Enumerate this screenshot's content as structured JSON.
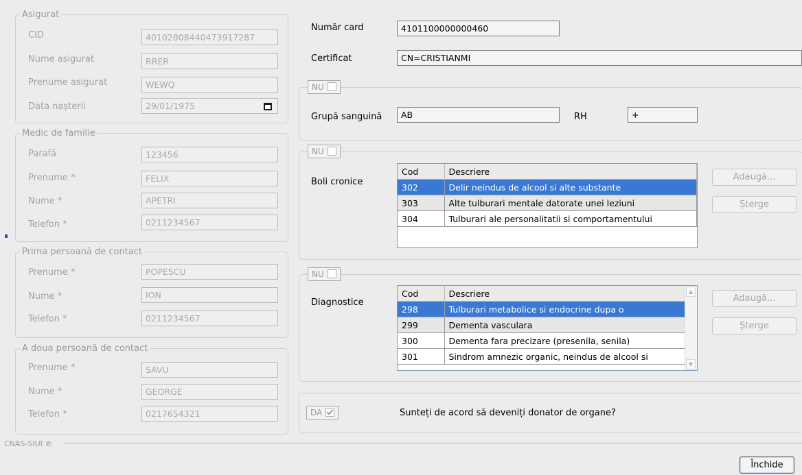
{
  "insured": {
    "title": "Asigurat",
    "cid_label": "CID",
    "cid_value": "40102808440473917287",
    "last_name_label": "Nume asigurat",
    "last_name_value": "RRER",
    "first_name_label": "Prenume asigurat",
    "first_name_value": "WEWQ",
    "birth_label": "Data nașterii",
    "birth_value": "29/01/1975"
  },
  "family_doctor": {
    "title": "Medic de familie",
    "stamp_label": "Parafă",
    "stamp_value": "123456",
    "first_name_label": "Prenume *",
    "first_name_value": "FELIX",
    "last_name_label": "Nume *",
    "last_name_value": "APETRI",
    "phone_label": "Telefon *",
    "phone_value": "0211234567"
  },
  "contact1": {
    "title": "Prima persoană de contact",
    "first_name_label": "Prenume *",
    "first_name_value": "POPESCU",
    "last_name_label": "Nume *",
    "last_name_value": "ION",
    "phone_label": "Telefon *",
    "phone_value": "0211234567"
  },
  "contact2": {
    "title": "A doua persoană de contact",
    "first_name_label": "Prenume *",
    "first_name_value": "SAVU",
    "last_name_label": "Nume *",
    "last_name_value": "GEORGE",
    "phone_label": "Telefon *",
    "phone_value": "0217654321"
  },
  "card": {
    "number_label": "Număr card",
    "number_value": "4101100000000460",
    "cert_label": "Certificat",
    "cert_value": "CN=CRISTIANMI"
  },
  "blood": {
    "toggle_label": "NU",
    "group_label": "Grupă sanguină",
    "group_value": "AB",
    "rh_label": "RH",
    "rh_value": "+"
  },
  "chronic": {
    "toggle_label": "NU",
    "label": "Boli cronice",
    "col_code": "Cod",
    "col_desc": "Descriere",
    "rows": [
      {
        "code": "302",
        "desc": "Delir neindus de alcool si alte substante"
      },
      {
        "code": "303",
        "desc": "Alte tulburari mentale datorate unei leziuni"
      },
      {
        "code": "304",
        "desc": "Tulburari ale personalitatii si comportamentului"
      }
    ],
    "add_label": "Adaugă...",
    "delete_label": "Șterge"
  },
  "diagnostics": {
    "toggle_label": "NU",
    "label": "Diagnostice",
    "col_code": "Cod",
    "col_desc": "Descriere",
    "rows": [
      {
        "code": "298",
        "desc": "Tulburari metabolice si endocrine dupa o"
      },
      {
        "code": "299",
        "desc": "Dementa vasculara"
      },
      {
        "code": "300",
        "desc": "Dementa fara precizare (presenila, senila)"
      },
      {
        "code": "301",
        "desc": "Sindrom amnezic organic, neindus de alcool si"
      }
    ],
    "add_label": "Adaugă...",
    "delete_label": "Șterge"
  },
  "donor": {
    "toggle_label": "DA",
    "question": "Sunteți de acord să deveniți donator de organe?"
  },
  "footer": {
    "brand": "CNAS-SIUI ®",
    "close_label": "Închide"
  }
}
